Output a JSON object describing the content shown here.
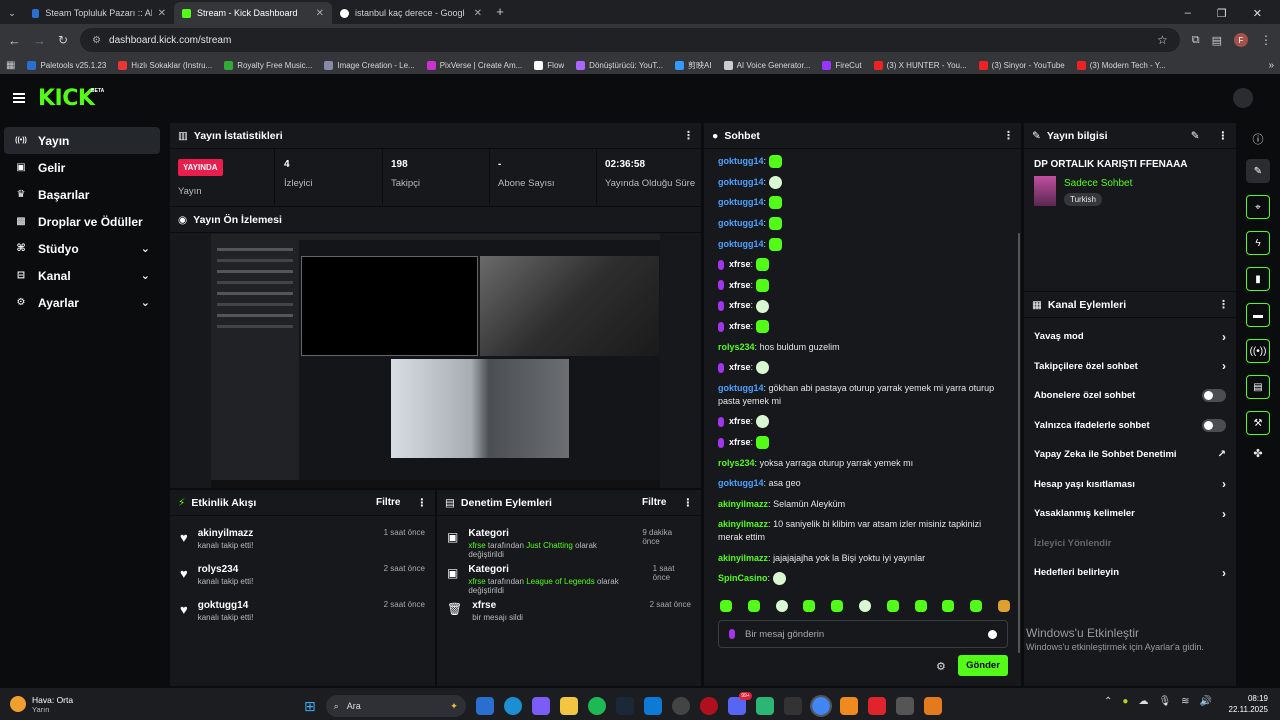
{
  "browser": {
    "tabs": [
      {
        "label": "Steam Topluluk Pazarı :: AK-47 |",
        "active": false
      },
      {
        "label": "Stream - Kick Dashboard",
        "active": true
      },
      {
        "label": "istanbul kaç derece - Google'da A",
        "active": false
      }
    ],
    "new_tab": "+",
    "url": "dashboard.kick.com/stream",
    "bookmarks": [
      "Paletools v25.1.23",
      "Hızlı Sokaklar (Instru...",
      "Royalty Free Music...",
      "Image Creation - Le...",
      "PixVerse | Create Am...",
      "Flow",
      "Dönüştürücü: YouT...",
      "剪映AI",
      "AI Voice Generator...",
      "FireCut",
      "(3) X HUNTER - You...",
      "(3) Sinyor - YouTube",
      "(3) Modern Tech - Y..."
    ],
    "bookmarks_more": "»",
    "profile_initial": "F"
  },
  "brand": {
    "logo": "KICK",
    "beta": "BETA"
  },
  "sidebar": {
    "items": [
      {
        "label": "Yayın",
        "icon": "broadcast-icon",
        "active": true,
        "expand": false
      },
      {
        "label": "Gelir",
        "icon": "wallet-icon",
        "active": false,
        "expand": false
      },
      {
        "label": "Başarılar",
        "icon": "trophy-icon",
        "active": false,
        "expand": false
      },
      {
        "label": "Droplar ve Ödüller",
        "icon": "gift-icon",
        "active": false,
        "expand": false
      },
      {
        "label": "Stüdyo",
        "icon": "studio-icon",
        "active": false,
        "expand": true
      },
      {
        "label": "Kanal",
        "icon": "channel-icon",
        "active": false,
        "expand": true
      },
      {
        "label": "Ayarlar",
        "icon": "gear-icon",
        "active": false,
        "expand": true
      }
    ]
  },
  "stats": {
    "title": "Yayın İstatistikleri",
    "live_badge": "YAYINDA",
    "live_label": "Yayın",
    "items": [
      {
        "value": "4",
        "label": "İzleyici"
      },
      {
        "value": "198",
        "label": "Takipçi"
      },
      {
        "value": "-",
        "label": "Abone Sayısı"
      },
      {
        "value": "02:36:58",
        "label": "Yayında Olduğu Süre"
      }
    ]
  },
  "preview": {
    "title": "Yayın Ön İzlemesi"
  },
  "activity": {
    "title": "Etkinlik Akışı",
    "filter": "Filtre",
    "items": [
      {
        "user": "akinyilmazz",
        "text": "kanalı takip etti!",
        "time": "1 saat önce"
      },
      {
        "user": "rolys234",
        "text": "kanalı takip etti!",
        "time": "2 saat önce"
      },
      {
        "user": "goktugg14",
        "text": "kanalı takip etti!",
        "time": "2 saat önce"
      }
    ]
  },
  "moderation": {
    "title": "Denetim Eylemleri",
    "filter": "Filtre",
    "items": [
      {
        "title": "Kategori",
        "user": "xfrse",
        "mid": "tarafından",
        "target": "Just Chatting",
        "end": "olarak değiştirildi",
        "time": "9 dakika önce"
      },
      {
        "title": "Kategori",
        "user": "xfrse",
        "mid": "tarafından",
        "target": "League of Legends",
        "end": "olarak değiştirildi",
        "time": "1 saat önce"
      },
      {
        "title": "xfrse",
        "user": "",
        "mid": "bir mesajı sildi",
        "target": "",
        "end": "",
        "time": "2 saat önce"
      }
    ]
  },
  "chat": {
    "title": "Sohbet",
    "messages": [
      {
        "user": "goktugg14",
        "color": "#4aa3ff",
        "text": "",
        "emote": "green",
        "mic": false
      },
      {
        "user": "goktugg14",
        "color": "#4aa3ff",
        "text": "",
        "emote": "skull",
        "mic": false
      },
      {
        "user": "goktugg14",
        "color": "#4aa3ff",
        "text": "",
        "emote": "green",
        "mic": false
      },
      {
        "user": "goktugg14",
        "color": "#4aa3ff",
        "text": "",
        "emote": "green",
        "mic": false
      },
      {
        "user": "goktugg14",
        "color": "#4aa3ff",
        "text": "",
        "emote": "green",
        "mic": false
      },
      {
        "user": "xfrse",
        "color": "#ffffff",
        "text": "",
        "emote": "green",
        "mic": true
      },
      {
        "user": "xfrse",
        "color": "#ffffff",
        "text": "",
        "emote": "green",
        "mic": true
      },
      {
        "user": "xfrse",
        "color": "#ffffff",
        "text": "",
        "emote": "skull",
        "mic": true
      },
      {
        "user": "xfrse",
        "color": "#ffffff",
        "text": "",
        "emote": "green",
        "mic": true
      },
      {
        "user": "rolys234",
        "color": "#53fc18",
        "text": "hos buldum guzelim",
        "emote": "",
        "mic": false
      },
      {
        "user": "xfrse",
        "color": "#ffffff",
        "text": "",
        "emote": "skull",
        "mic": true
      },
      {
        "user": "goktugg14",
        "color": "#4aa3ff",
        "text": "gökhan abi pastaya oturup yarrak yemek mi yarra oturup pasta yemek mi",
        "emote": "",
        "mic": false
      },
      {
        "user": "xfrse",
        "color": "#ffffff",
        "text": "",
        "emote": "skull",
        "mic": true
      },
      {
        "user": "xfrse",
        "color": "#ffffff",
        "text": "",
        "emote": "green",
        "mic": true
      },
      {
        "user": "rolys234",
        "color": "#53fc18",
        "text": "yoksa yarraga oturup yarrak yemek mı",
        "emote": "",
        "mic": false
      },
      {
        "user": "goktugg14",
        "color": "#4aa3ff",
        "text": "asa geo",
        "emote": "",
        "mic": false
      },
      {
        "user": "akinyilmazz",
        "color": "#53fc18",
        "text": "Selamün Aleyküm",
        "emote": "",
        "mic": false
      },
      {
        "user": "akinyilmazz",
        "color": "#53fc18",
        "text": "10 saniyelik bi klibim var atsam izler misiniz tapkinizi merak ettim",
        "emote": "",
        "mic": false
      },
      {
        "user": "akinyilmazz",
        "color": "#53fc18",
        "text": "jajajajajha yok la Bişi yoktu iyi yayınlar",
        "emote": "",
        "mic": false
      },
      {
        "user": "SpinCasino",
        "color": "#53fc18",
        "text": "",
        "emote": "skull",
        "mic": false
      }
    ],
    "placeholder": "Bir mesaj gönderin",
    "send": "Gönder"
  },
  "stream_info": {
    "title": "Yayın bilgisi",
    "stream_title": "DP ORTALIK KARIŞTI FFENAAA",
    "category": "Sadece Sohbet",
    "language": "Turkish"
  },
  "channel_actions": {
    "title": "Kanal Eylemleri",
    "items": [
      {
        "label": "Yavaş mod",
        "type": "chevron",
        "disabled": false
      },
      {
        "label": "Takipçilere özel sohbet",
        "type": "chevron",
        "disabled": false
      },
      {
        "label": "Abonelere özel sohbet",
        "type": "toggle",
        "disabled": false
      },
      {
        "label": "Yalnızca ifadelerle sohbet",
        "type": "toggle",
        "disabled": false
      },
      {
        "label": "Yapay Zeka ile Sohbet Denetimi",
        "type": "external",
        "disabled": false
      },
      {
        "label": "Hesap yaşı kısıtlaması",
        "type": "chevron",
        "disabled": false
      },
      {
        "label": "Yasaklanmış kelimeler",
        "type": "chevron",
        "disabled": false
      },
      {
        "label": "İzleyici Yönlendir",
        "type": "none",
        "disabled": true
      },
      {
        "label": "Hedefleri belirleyin",
        "type": "chevron",
        "disabled": false
      }
    ]
  },
  "watermark": {
    "title": "Windows'u Etkinleştir",
    "sub": "Windows'u etkinleştirmek için Ayarlar'a gidin."
  },
  "taskbar": {
    "weather_title": "Hava: Orta",
    "weather_sub": "Yarın",
    "search": "Ara",
    "time": "08:19",
    "date": "22.11.2025",
    "badge": "99+"
  },
  "colors": {
    "accent": "#53fc18",
    "live": "#e91e4c",
    "username_blue": "#4aa3ff",
    "mic_purple": "#a335ee"
  }
}
